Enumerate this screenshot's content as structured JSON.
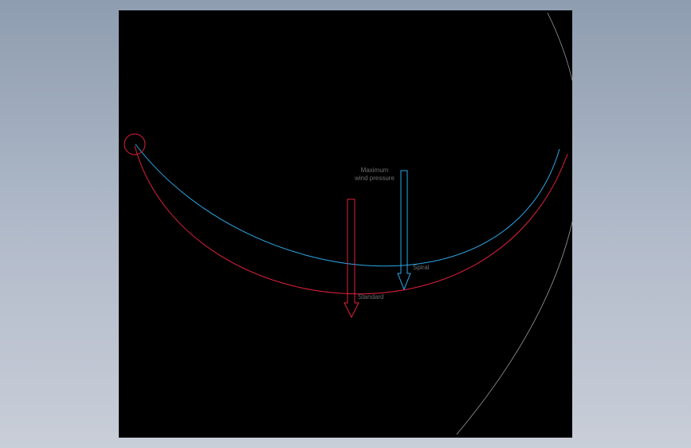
{
  "labels": {
    "max_wind_line1": "Maximum",
    "max_wind_line2": "wind pressure",
    "spiral": "Spiral",
    "standard": "Standard"
  },
  "colors": {
    "background_top": "#8e9db0",
    "background_bottom": "#c9ced8",
    "canvas": "#000000",
    "standard_curve": "#e0203a",
    "spiral_curve": "#2aa8e6",
    "outer_arc": "#9a9a9a",
    "label_text": "#6f6f6f"
  },
  "icons": {
    "hub": "circle-outline"
  }
}
